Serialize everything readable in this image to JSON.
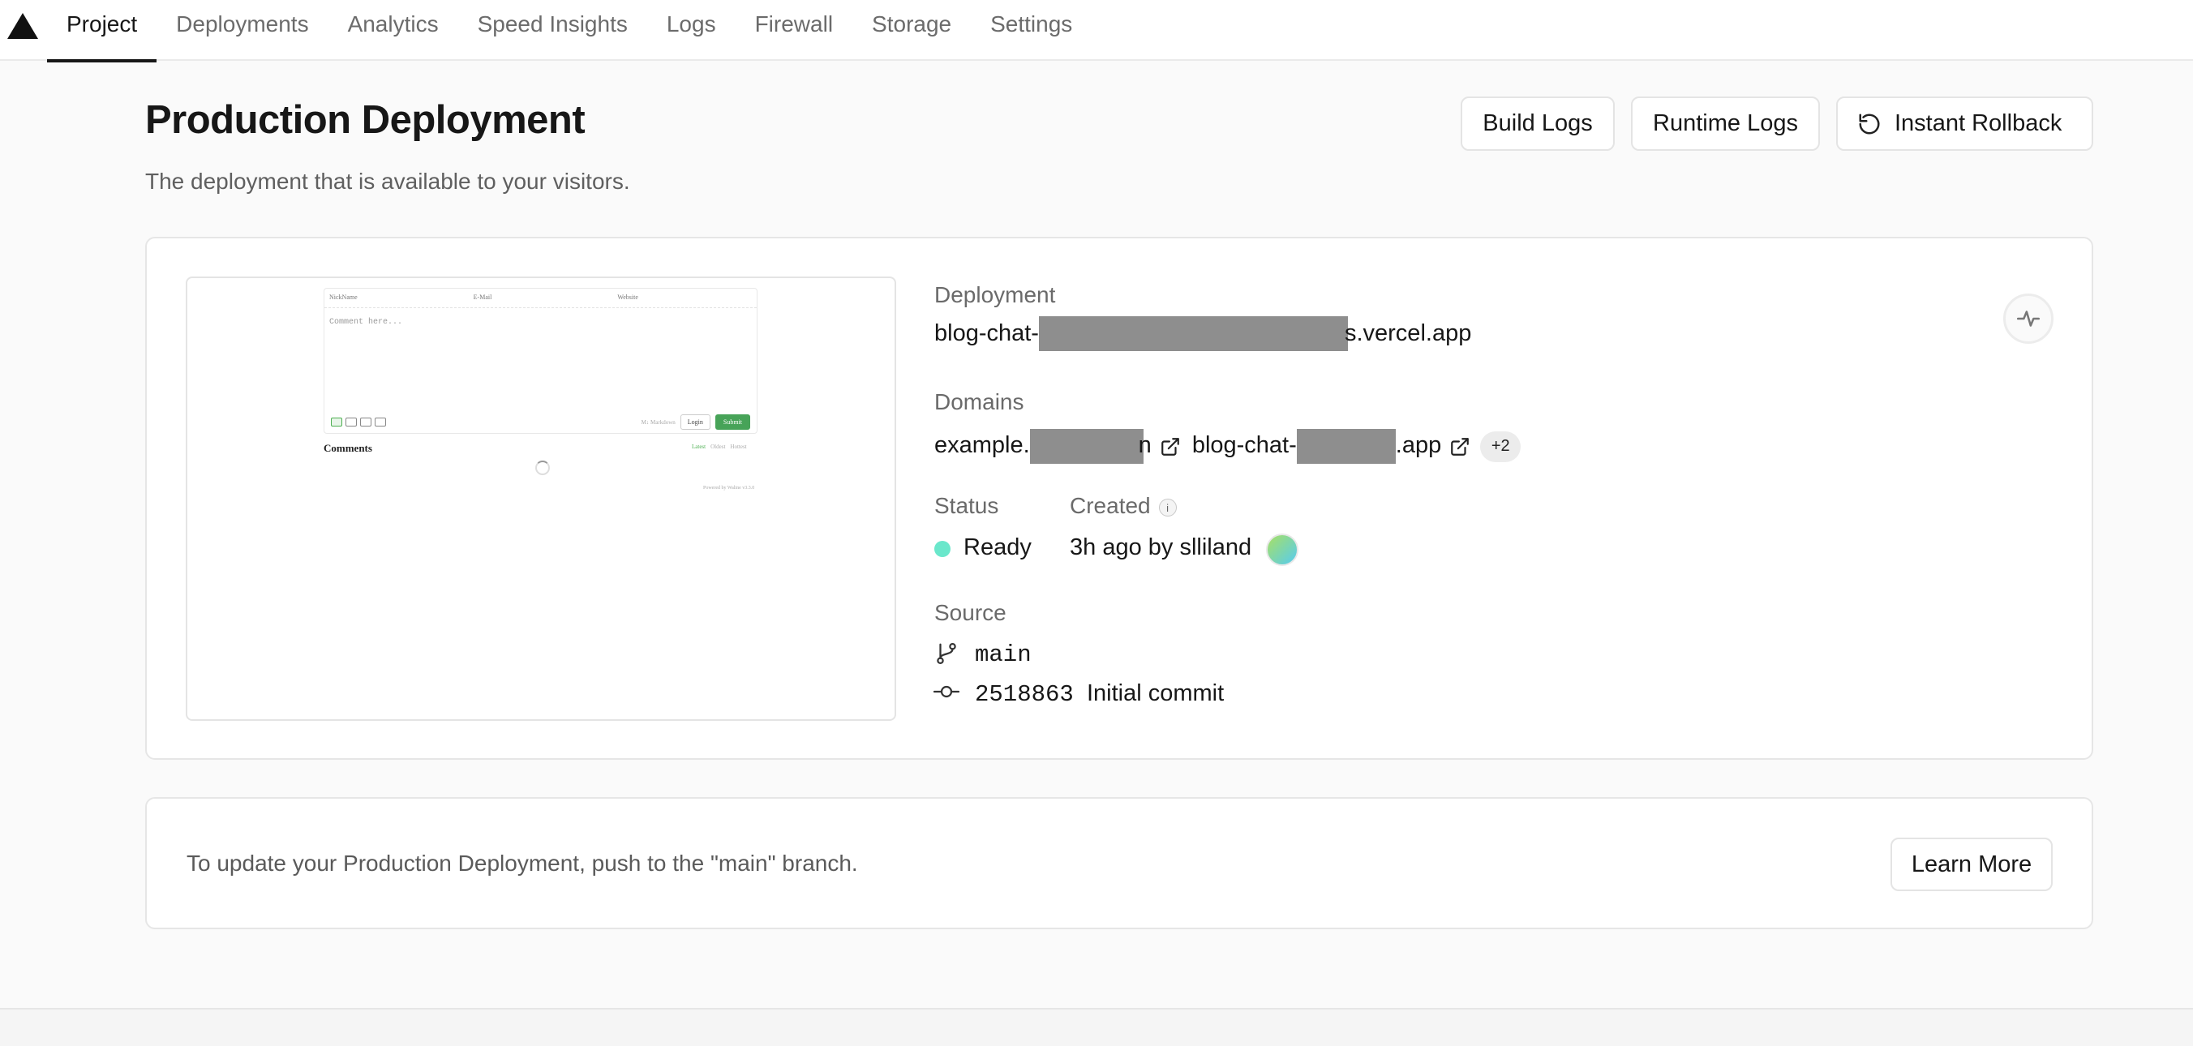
{
  "nav": {
    "tabs": [
      {
        "label": "Project",
        "active": true
      },
      {
        "label": "Deployments"
      },
      {
        "label": "Analytics"
      },
      {
        "label": "Speed Insights"
      },
      {
        "label": "Logs"
      },
      {
        "label": "Firewall"
      },
      {
        "label": "Storage"
      },
      {
        "label": "Settings"
      }
    ]
  },
  "header": {
    "title": "Production Deployment",
    "subtitle": "The deployment that is available to your visitors.",
    "build_logs": "Build Logs",
    "runtime_logs": "Runtime Logs",
    "instant_rollback": "Instant Rollback"
  },
  "preview": {
    "fields": [
      "NickName",
      "E-Mail",
      "Website"
    ],
    "placeholder": "Comment here...",
    "markdown": "M↓ Markdown",
    "login": "Login",
    "submit": "Submit",
    "comments_title": "Comments",
    "sort": [
      "Latest",
      "Oldest",
      "Hottest"
    ],
    "powered": "Powered by Waline v3.3.0"
  },
  "deployment": {
    "label": "Deployment",
    "url_prefix": "blog-chat-",
    "url_suffix": "s.vercel.app"
  },
  "domains": {
    "label": "Domains",
    "d1_prefix": "example.",
    "d1_suffix": "n",
    "d2_prefix": "blog-chat-",
    "d2_suffix": ".app",
    "more": "+2"
  },
  "status": {
    "label": "Status",
    "value": "Ready",
    "dot_color": "#50e3c2"
  },
  "created": {
    "label": "Created",
    "info": "i",
    "value": "3h ago by slliland"
  },
  "source": {
    "label": "Source",
    "branch": "main",
    "commit_hash": "2518863",
    "commit_message": "Initial commit"
  },
  "notice": {
    "text": "To update your Production Deployment, push to the \"main\" branch.",
    "learn_more": "Learn More"
  }
}
